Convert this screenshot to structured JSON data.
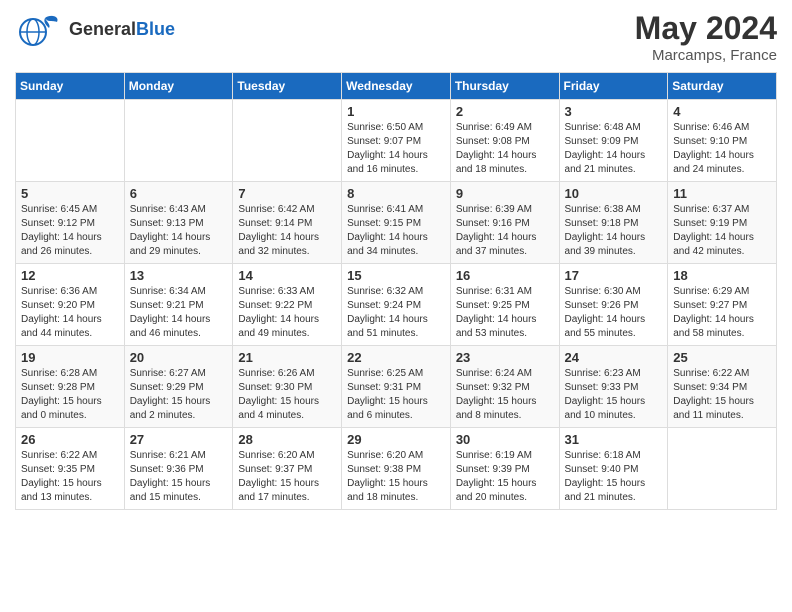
{
  "logo": {
    "general": "General",
    "blue": "Blue"
  },
  "title": {
    "month_year": "May 2024",
    "location": "Marcamps, France"
  },
  "days_of_week": [
    "Sunday",
    "Monday",
    "Tuesday",
    "Wednesday",
    "Thursday",
    "Friday",
    "Saturday"
  ],
  "weeks": [
    [
      {
        "day": "",
        "detail": ""
      },
      {
        "day": "",
        "detail": ""
      },
      {
        "day": "",
        "detail": ""
      },
      {
        "day": "1",
        "detail": "Sunrise: 6:50 AM\nSunset: 9:07 PM\nDaylight: 14 hours\nand 16 minutes."
      },
      {
        "day": "2",
        "detail": "Sunrise: 6:49 AM\nSunset: 9:08 PM\nDaylight: 14 hours\nand 18 minutes."
      },
      {
        "day": "3",
        "detail": "Sunrise: 6:48 AM\nSunset: 9:09 PM\nDaylight: 14 hours\nand 21 minutes."
      },
      {
        "day": "4",
        "detail": "Sunrise: 6:46 AM\nSunset: 9:10 PM\nDaylight: 14 hours\nand 24 minutes."
      }
    ],
    [
      {
        "day": "5",
        "detail": "Sunrise: 6:45 AM\nSunset: 9:12 PM\nDaylight: 14 hours\nand 26 minutes."
      },
      {
        "day": "6",
        "detail": "Sunrise: 6:43 AM\nSunset: 9:13 PM\nDaylight: 14 hours\nand 29 minutes."
      },
      {
        "day": "7",
        "detail": "Sunrise: 6:42 AM\nSunset: 9:14 PM\nDaylight: 14 hours\nand 32 minutes."
      },
      {
        "day": "8",
        "detail": "Sunrise: 6:41 AM\nSunset: 9:15 PM\nDaylight: 14 hours\nand 34 minutes."
      },
      {
        "day": "9",
        "detail": "Sunrise: 6:39 AM\nSunset: 9:16 PM\nDaylight: 14 hours\nand 37 minutes."
      },
      {
        "day": "10",
        "detail": "Sunrise: 6:38 AM\nSunset: 9:18 PM\nDaylight: 14 hours\nand 39 minutes."
      },
      {
        "day": "11",
        "detail": "Sunrise: 6:37 AM\nSunset: 9:19 PM\nDaylight: 14 hours\nand 42 minutes."
      }
    ],
    [
      {
        "day": "12",
        "detail": "Sunrise: 6:36 AM\nSunset: 9:20 PM\nDaylight: 14 hours\nand 44 minutes."
      },
      {
        "day": "13",
        "detail": "Sunrise: 6:34 AM\nSunset: 9:21 PM\nDaylight: 14 hours\nand 46 minutes."
      },
      {
        "day": "14",
        "detail": "Sunrise: 6:33 AM\nSunset: 9:22 PM\nDaylight: 14 hours\nand 49 minutes."
      },
      {
        "day": "15",
        "detail": "Sunrise: 6:32 AM\nSunset: 9:24 PM\nDaylight: 14 hours\nand 51 minutes."
      },
      {
        "day": "16",
        "detail": "Sunrise: 6:31 AM\nSunset: 9:25 PM\nDaylight: 14 hours\nand 53 minutes."
      },
      {
        "day": "17",
        "detail": "Sunrise: 6:30 AM\nSunset: 9:26 PM\nDaylight: 14 hours\nand 55 minutes."
      },
      {
        "day": "18",
        "detail": "Sunrise: 6:29 AM\nSunset: 9:27 PM\nDaylight: 14 hours\nand 58 minutes."
      }
    ],
    [
      {
        "day": "19",
        "detail": "Sunrise: 6:28 AM\nSunset: 9:28 PM\nDaylight: 15 hours\nand 0 minutes."
      },
      {
        "day": "20",
        "detail": "Sunrise: 6:27 AM\nSunset: 9:29 PM\nDaylight: 15 hours\nand 2 minutes."
      },
      {
        "day": "21",
        "detail": "Sunrise: 6:26 AM\nSunset: 9:30 PM\nDaylight: 15 hours\nand 4 minutes."
      },
      {
        "day": "22",
        "detail": "Sunrise: 6:25 AM\nSunset: 9:31 PM\nDaylight: 15 hours\nand 6 minutes."
      },
      {
        "day": "23",
        "detail": "Sunrise: 6:24 AM\nSunset: 9:32 PM\nDaylight: 15 hours\nand 8 minutes."
      },
      {
        "day": "24",
        "detail": "Sunrise: 6:23 AM\nSunset: 9:33 PM\nDaylight: 15 hours\nand 10 minutes."
      },
      {
        "day": "25",
        "detail": "Sunrise: 6:22 AM\nSunset: 9:34 PM\nDaylight: 15 hours\nand 11 minutes."
      }
    ],
    [
      {
        "day": "26",
        "detail": "Sunrise: 6:22 AM\nSunset: 9:35 PM\nDaylight: 15 hours\nand 13 minutes."
      },
      {
        "day": "27",
        "detail": "Sunrise: 6:21 AM\nSunset: 9:36 PM\nDaylight: 15 hours\nand 15 minutes."
      },
      {
        "day": "28",
        "detail": "Sunrise: 6:20 AM\nSunset: 9:37 PM\nDaylight: 15 hours\nand 17 minutes."
      },
      {
        "day": "29",
        "detail": "Sunrise: 6:20 AM\nSunset: 9:38 PM\nDaylight: 15 hours\nand 18 minutes."
      },
      {
        "day": "30",
        "detail": "Sunrise: 6:19 AM\nSunset: 9:39 PM\nDaylight: 15 hours\nand 20 minutes."
      },
      {
        "day": "31",
        "detail": "Sunrise: 6:18 AM\nSunset: 9:40 PM\nDaylight: 15 hours\nand 21 minutes."
      },
      {
        "day": "",
        "detail": ""
      }
    ]
  ]
}
